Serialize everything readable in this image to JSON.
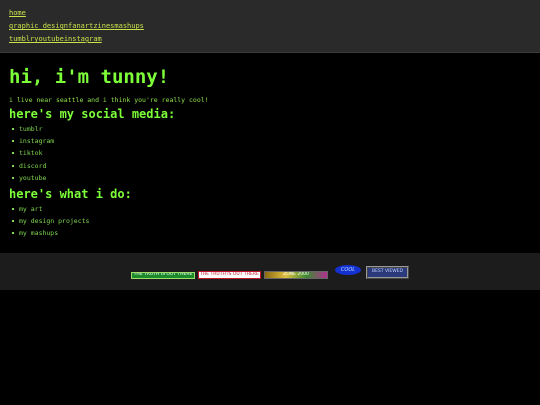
{
  "nav": {
    "row1": [
      "home"
    ],
    "row2": [
      "graphic design",
      "fanart",
      "zines",
      "mashups"
    ],
    "row3": [
      "tumblr",
      "youtube",
      "instagram"
    ]
  },
  "main": {
    "title": "hi, i'm tunny!",
    "intro": "i live near seattle and i think you're really cool!",
    "social_heading": "here's my social media:",
    "social_links": [
      "tumblr",
      "instagram",
      "tiktok",
      "discord",
      "youtube"
    ],
    "work_heading": "here's what i do:",
    "work_links": [
      "my art",
      "my design projects",
      "my mashups"
    ]
  },
  "footer": {
    "badges": [
      {
        "name": "badge-1",
        "text": "THE TRUTH IS OUT THERE"
      },
      {
        "name": "badge-2",
        "text": "THE TRUTH IS OUT THERE"
      },
      {
        "name": "badge-3",
        "text": "ZONE 2000"
      },
      {
        "name": "badge-4",
        "text": "COOL"
      },
      {
        "name": "badge-5",
        "text": "BEST VIEWED"
      }
    ]
  }
}
